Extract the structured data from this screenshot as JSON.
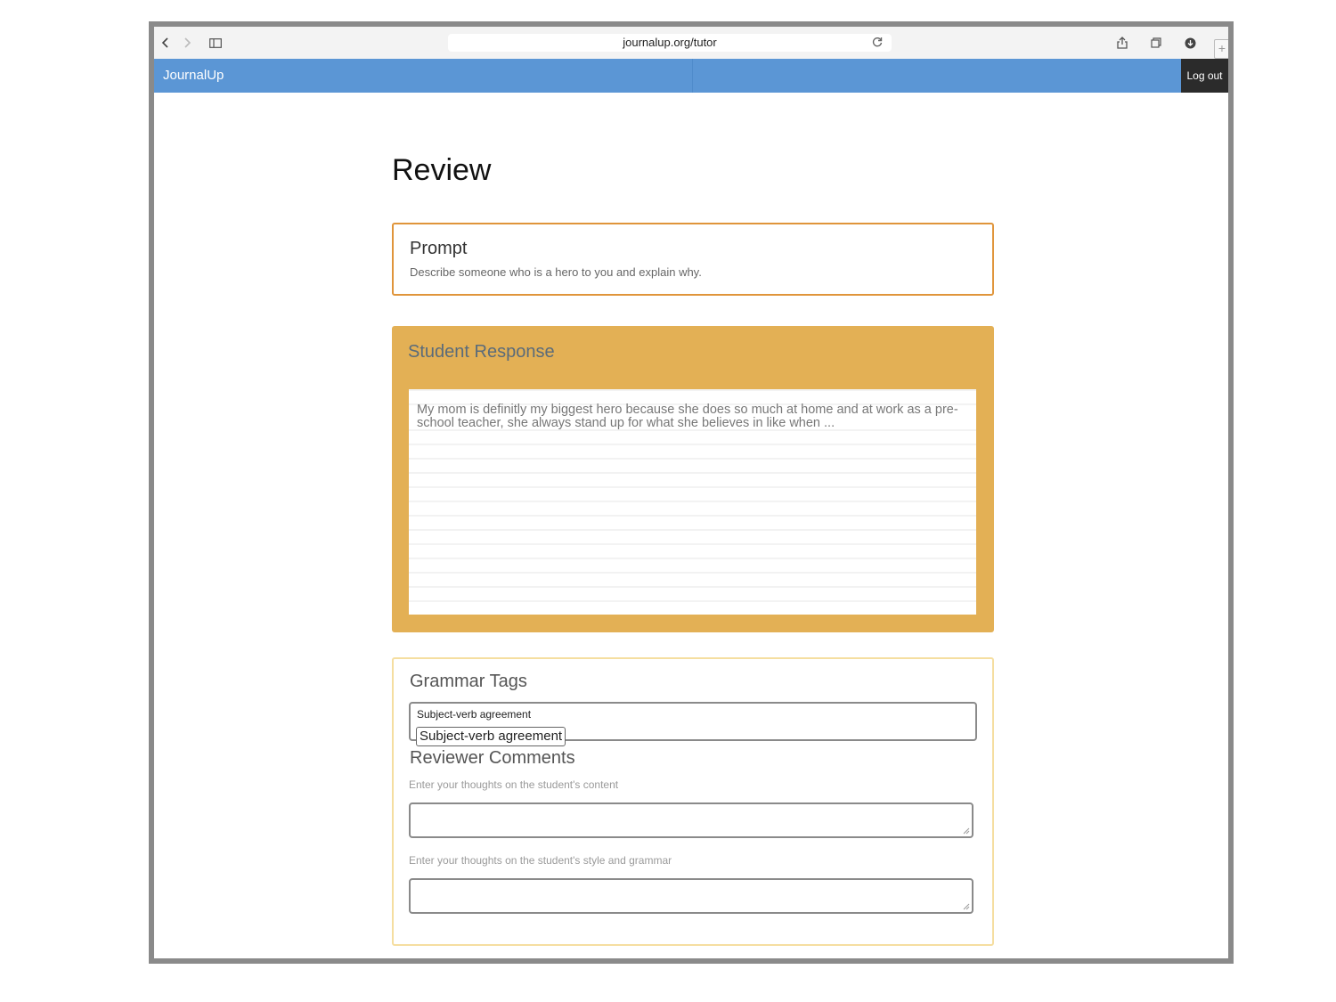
{
  "browser": {
    "url": "journalup.org/tutor",
    "plus_label": "+"
  },
  "navbar": {
    "brand": "JournalUp",
    "logout_label": "Log out"
  },
  "page": {
    "title": "Review"
  },
  "prompt": {
    "heading": "Prompt",
    "text": "Describe someone who is a hero to you and explain why."
  },
  "student_response": {
    "heading": "Student Response",
    "text": "My mom is definitly my biggest hero because she does so much at home and at work as a pre-school teacher, she always stand up for what she believes in like when ..."
  },
  "grammar": {
    "heading": "Grammar Tags",
    "input_value": "Subject-verb agreement",
    "chip_label": "Subject-verb agreement"
  },
  "comments": {
    "heading": "Reviewer Comments",
    "content_hint": "Enter your thoughts on the student's content",
    "style_hint": "Enter your thoughts on the student's style and grammar",
    "content_value": "",
    "style_value": ""
  },
  "colors": {
    "navbar": "#5b96d5",
    "prompt_border": "#e0953b",
    "response_bg": "#e3b055",
    "grammar_border": "#f5dea0"
  }
}
